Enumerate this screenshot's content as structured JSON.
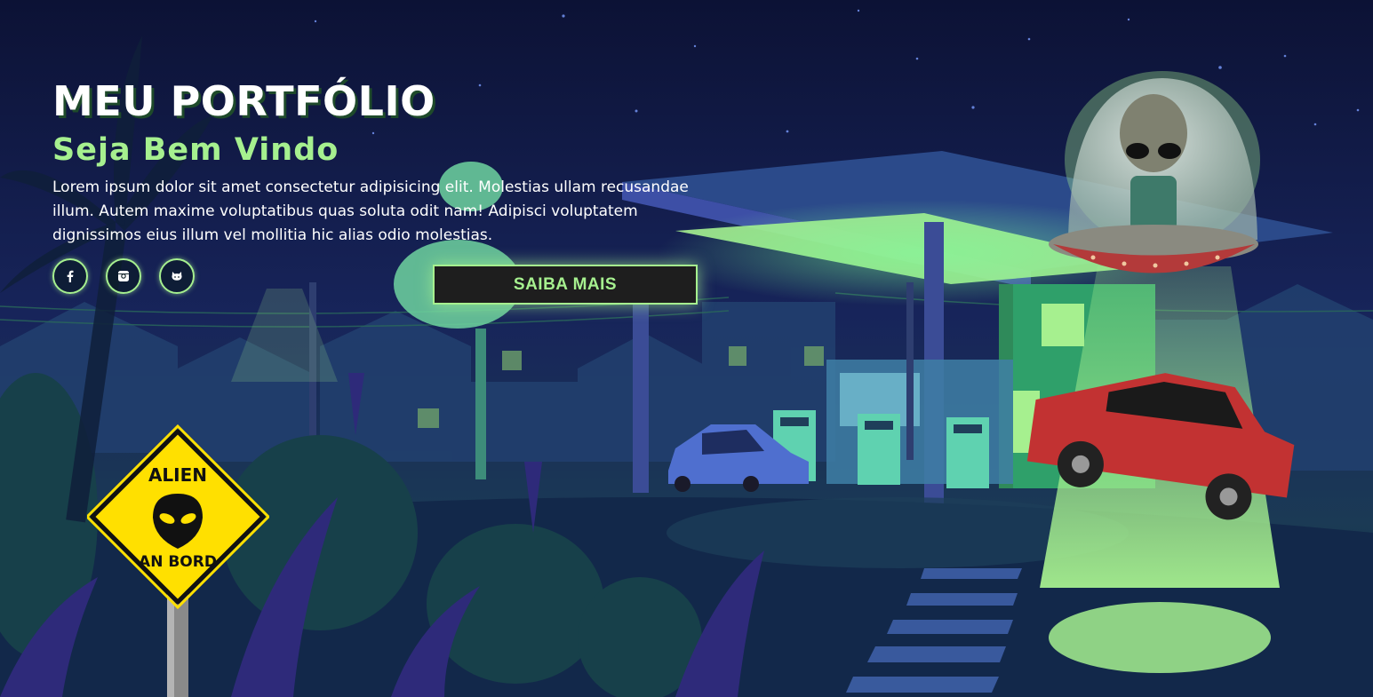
{
  "hero": {
    "title": "MEU PORTFÓLIO",
    "subtitle": "Seja Bem Vindo",
    "description": "Lorem ipsum dolor sit amet consectetur adipisicing elit. Molestias ullam recusandae illum. Autem maxime voluptatibus quas soluta odit nam! Adipisci voluptatem dignissimos eius illum vel mollitia hic alias odio molestias.",
    "cta_label": "SAIBA MAIS"
  },
  "socials": [
    {
      "name": "facebook",
      "icon": "facebook-icon"
    },
    {
      "name": "instagram",
      "icon": "instagram-icon"
    },
    {
      "name": "github",
      "icon": "github-icon"
    }
  ],
  "sign": {
    "line1": "ALIEN",
    "line2": "AN BORD"
  },
  "colors": {
    "accent": "#a6f08f",
    "background": "#0c1438",
    "sign_yellow": "#ffe000"
  }
}
